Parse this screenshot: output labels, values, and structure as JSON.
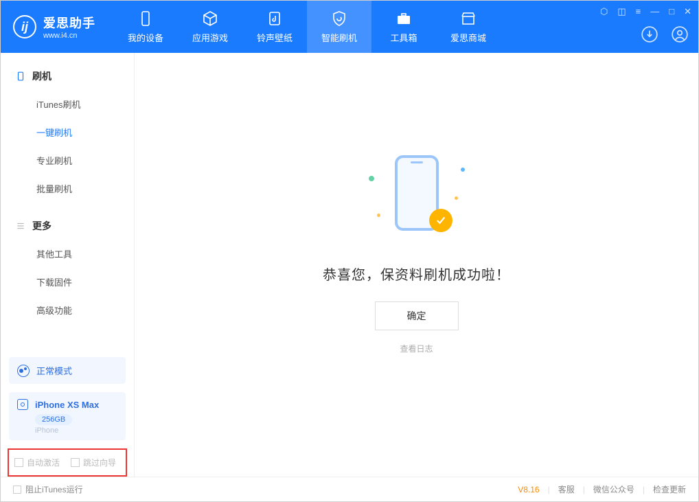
{
  "app": {
    "name": "爱思助手",
    "url": "www.i4.cn"
  },
  "tabs": [
    {
      "label": "我的设备"
    },
    {
      "label": "应用游戏"
    },
    {
      "label": "铃声壁纸"
    },
    {
      "label": "智能刷机"
    },
    {
      "label": "工具箱"
    },
    {
      "label": "爱思商城"
    }
  ],
  "sidebar": {
    "group1": {
      "title": "刷机",
      "items": [
        "iTunes刷机",
        "一键刷机",
        "专业刷机",
        "批量刷机"
      ]
    },
    "group2": {
      "title": "更多",
      "items": [
        "其他工具",
        "下载固件",
        "高级功能"
      ]
    },
    "mode": "正常模式",
    "device": {
      "name": "iPhone XS Max",
      "capacity": "256GB",
      "type": "iPhone"
    },
    "opts": {
      "auto_activate": "自动激活",
      "skip_guide": "跳过向导"
    }
  },
  "main": {
    "success": "恭喜您，保资料刷机成功啦！",
    "ok": "确定",
    "view_log": "查看日志"
  },
  "footer": {
    "block_itunes": "阻止iTunes运行",
    "version": "V8.16",
    "service": "客服",
    "wechat": "微信公众号",
    "check_update": "检查更新"
  }
}
